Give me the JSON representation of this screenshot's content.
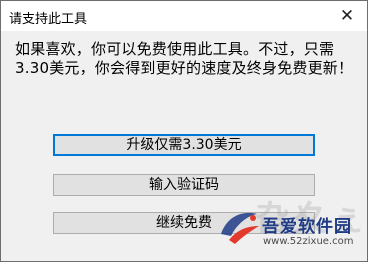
{
  "dialog": {
    "title": "请支持此工具",
    "close_glyph": "✕",
    "message": "如果喜欢，你可以免费使用此工具。不过，只需3.30美元，你会得到更好的速度及终身免费更新！",
    "buttons": {
      "upgrade": "升级仅需3.30美元",
      "enter_code": "输入验证码",
      "continue_free": "继续免费"
    }
  },
  "watermark": {
    "faint_text": "旮夊ぇ鑰",
    "brand": "吾爱软件园",
    "site": "www.52zixue.com",
    "logo_colors": [
      "#1f3b86",
      "#e23b2e"
    ]
  }
}
